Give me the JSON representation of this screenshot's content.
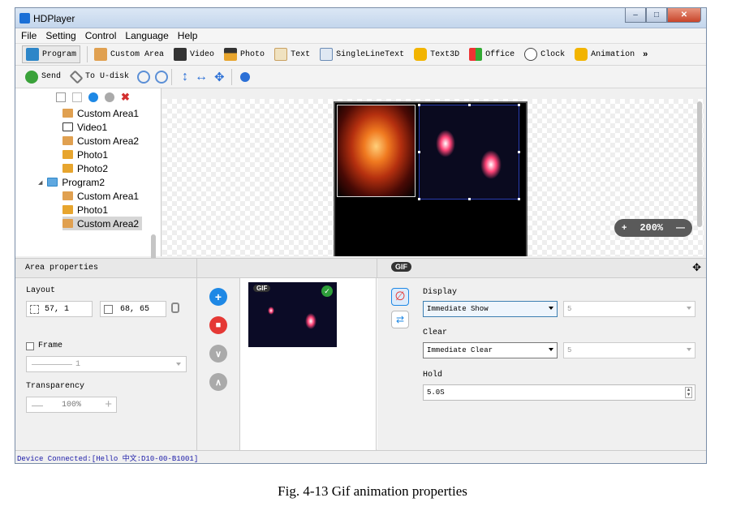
{
  "app": {
    "title": "HDPlayer"
  },
  "menu": [
    "File",
    "Setting",
    "Control",
    "Language",
    "Help"
  ],
  "toolbar1": [
    {
      "label": "Program",
      "icon": "program-icon"
    },
    {
      "label": "Custom Area",
      "icon": "custom-area-icon"
    },
    {
      "label": "Video",
      "icon": "video-icon"
    },
    {
      "label": "Photo",
      "icon": "photo-icon"
    },
    {
      "label": "Text",
      "icon": "text-icon"
    },
    {
      "label": "SingleLineText",
      "icon": "single-line-text-icon"
    },
    {
      "label": "Text3D",
      "icon": "text3d-icon"
    },
    {
      "label": "Office",
      "icon": "office-icon"
    },
    {
      "label": "Clock",
      "icon": "clock-icon"
    },
    {
      "label": "Animation",
      "icon": "animation-icon"
    }
  ],
  "toolbar1_more": "»",
  "toolbar2": {
    "send": "Send",
    "to_udisk": "To U-disk"
  },
  "tree": [
    {
      "label": "Custom Area1",
      "type": "custom-area"
    },
    {
      "label": "Video1",
      "type": "video"
    },
    {
      "label": "Custom Area2",
      "type": "custom-area"
    },
    {
      "label": "Photo1",
      "type": "photo"
    },
    {
      "label": "Photo2",
      "type": "photo"
    },
    {
      "label": "Program2",
      "type": "program"
    },
    {
      "label": "Custom Area1",
      "type": "custom-area"
    },
    {
      "label": "Photo1",
      "type": "photo"
    },
    {
      "label": "Custom Area2",
      "type": "custom-area",
      "selected": true
    }
  ],
  "zoom": {
    "value": "200%",
    "minus": "+",
    "plus": "—"
  },
  "area_properties": {
    "title": "Area properties",
    "layout_label": "Layout",
    "position": "57, 1",
    "size": "68, 65",
    "frame_label": "Frame",
    "frame_value": "1",
    "transparency_label": "Transparency",
    "transparency_value": "100%"
  },
  "gif_panel": {
    "badge": "GIF",
    "thumb_badge": "GIF",
    "display_label": "Display",
    "display_value": "Immediate Show",
    "display_speed": "5",
    "clear_label": "Clear",
    "clear_value": "Immediate Clear",
    "clear_speed": "5",
    "hold_label": "Hold",
    "hold_value": "5.0S"
  },
  "status": "Device Connected:[Hello 中文:D10-00-B1001]",
  "caption": "Fig. 4-13 Gif animation properties",
  "colors": {
    "accent": "#1e88e5",
    "delete": "#e53935",
    "ok": "#2e9e3a"
  }
}
